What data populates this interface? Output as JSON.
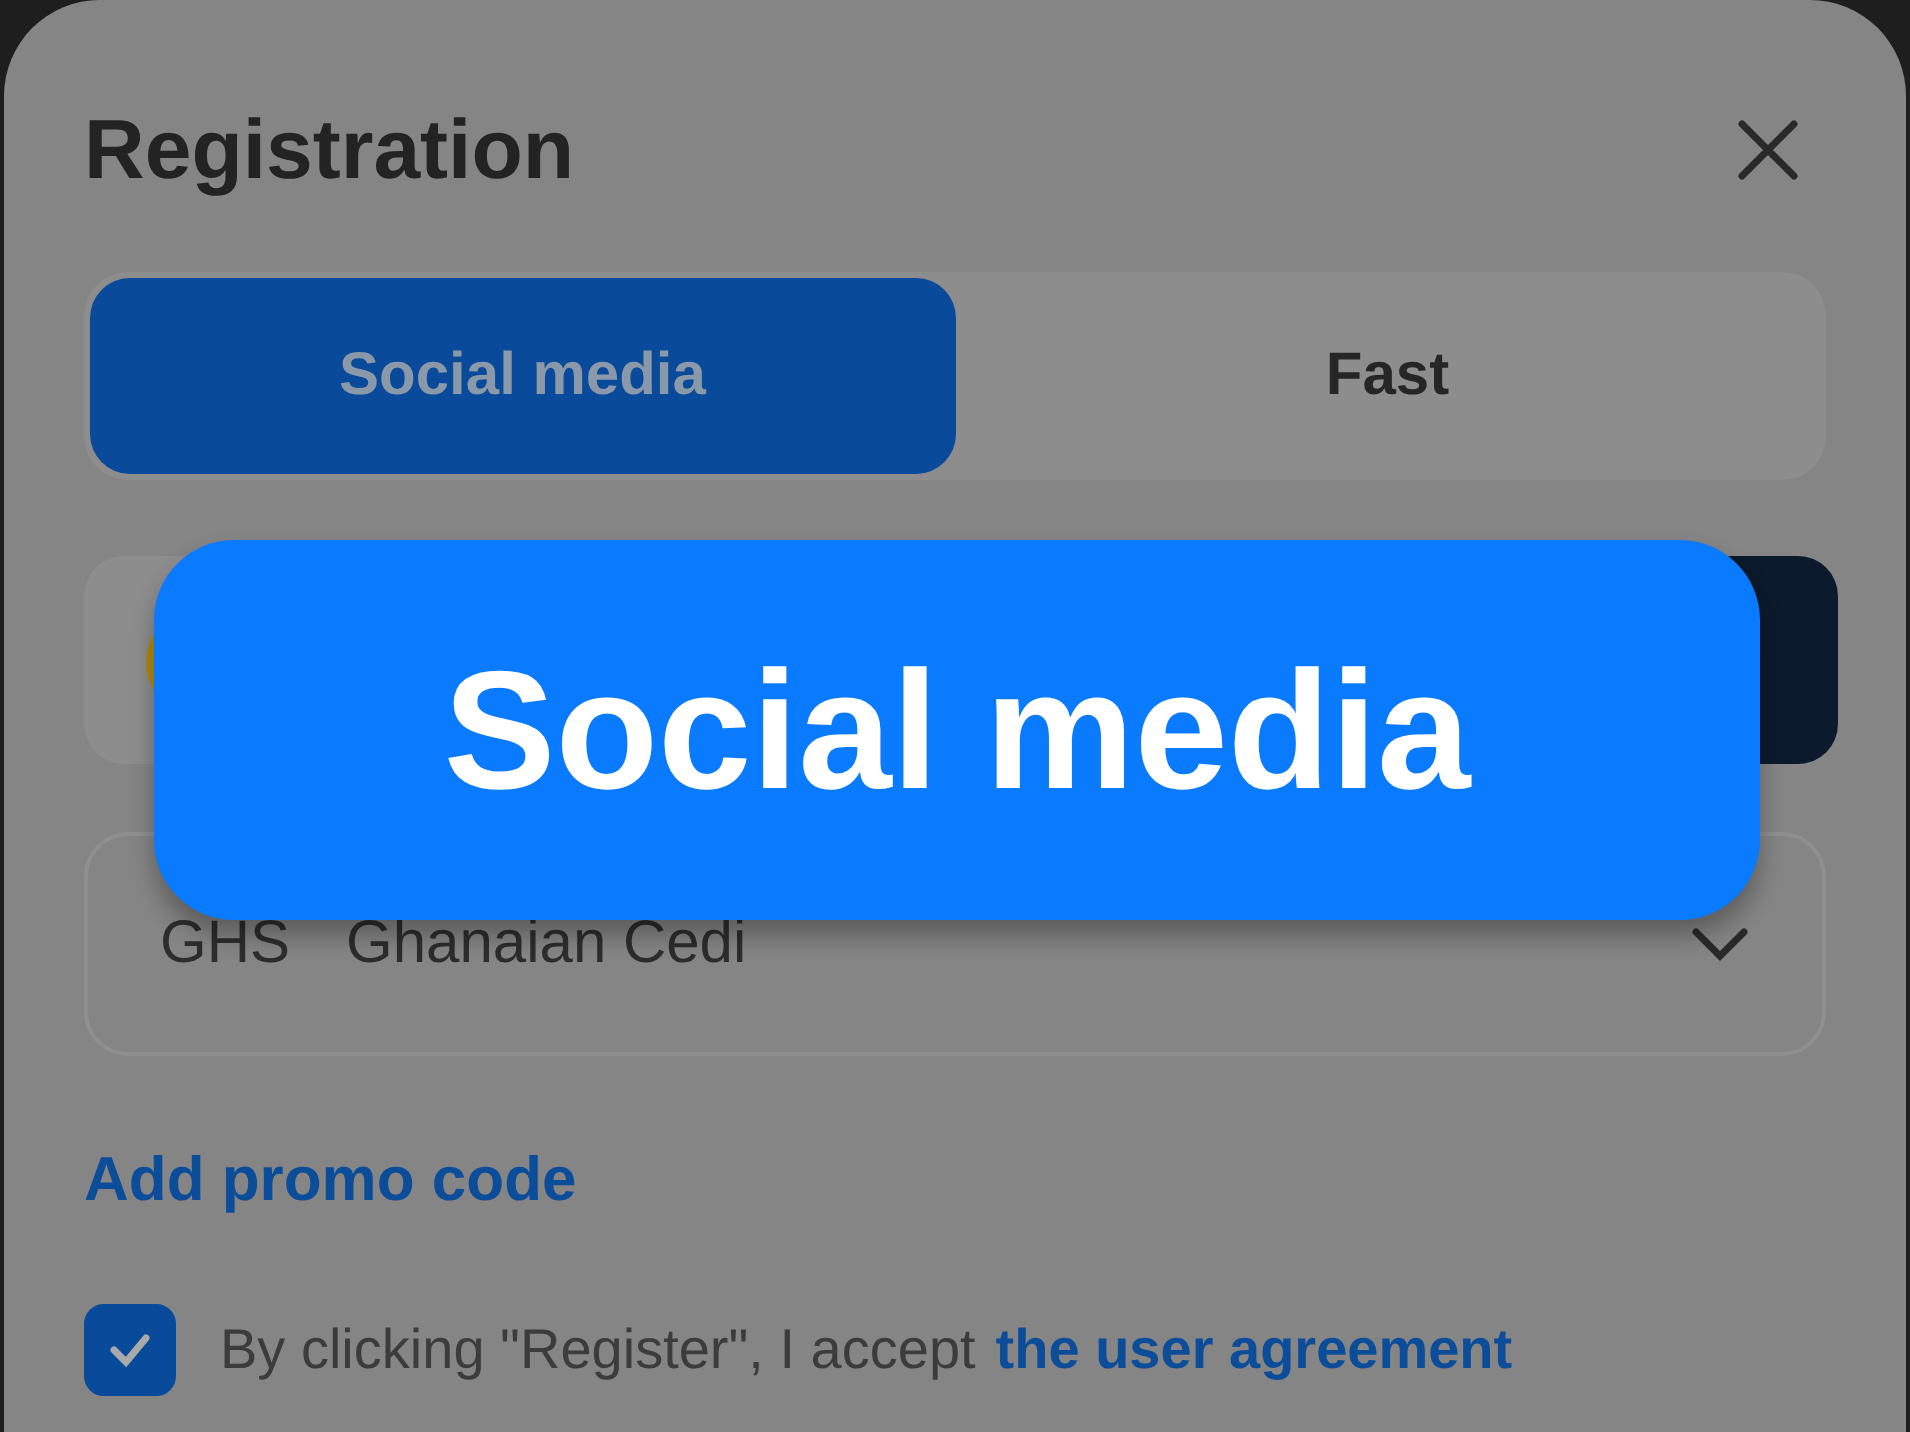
{
  "dialog": {
    "title": "Registration",
    "tabs": [
      {
        "label": "Social media",
        "selected": true
      },
      {
        "label": "Fast",
        "selected": false
      }
    ],
    "currency": {
      "code": "GHS",
      "name": "Ghanaian Cedi"
    },
    "promo_link": "Add promo code",
    "agreement": {
      "checked": true,
      "text": "By clicking \"Register\", I accept",
      "link": "the user agreement"
    }
  },
  "callout": {
    "text": "Social media"
  }
}
